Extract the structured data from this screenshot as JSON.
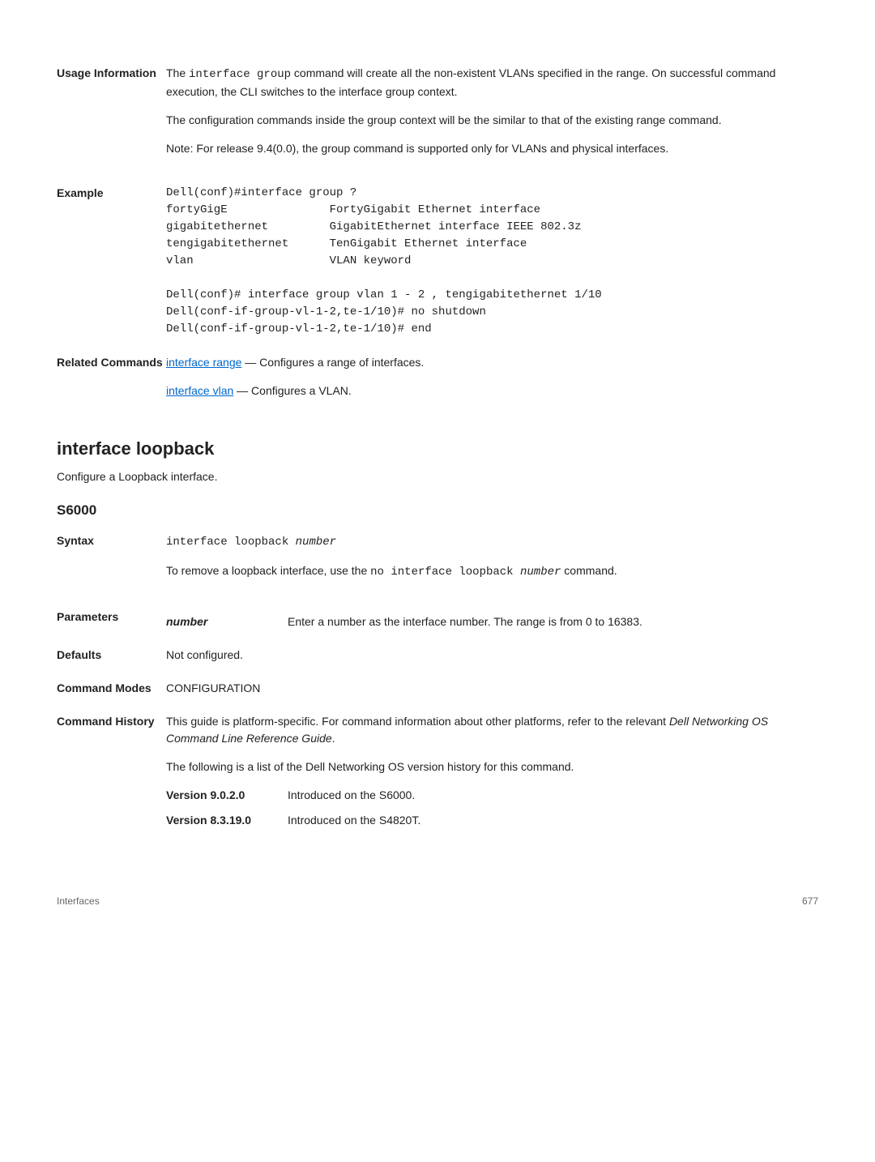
{
  "usage": {
    "label": "Usage Information",
    "p1a": "The ",
    "p1code": "interface group",
    "p1b": " command will create all the non-existent VLANs specified in the range. On successful command execution, the CLI switches to the interface group context.",
    "p2": "The configuration commands inside the group context will be the similar to that of the existing range command.",
    "p3": "Note: For release 9.4(0.0), the group command is supported only for VLANs and physical interfaces."
  },
  "example": {
    "label": "Example",
    "code": "Dell(conf)#interface group ?\nfortyGigE               FortyGigabit Ethernet interface\ngigabitethernet         GigabitEthernet interface IEEE 802.3z\ntengigabitethernet      TenGigabit Ethernet interface\nvlan                    VLAN keyword\n\nDell(conf)# interface group vlan 1 - 2 , tengigabitethernet 1/10\nDell(conf-if-group-vl-1-2,te-1/10)# no shutdown\nDell(conf-if-group-vl-1-2,te-1/10)# end"
  },
  "related": {
    "label": "Related Commands",
    "link1": "interface range",
    "desc1": " — Configures a range of interfaces.",
    "link2": "interface vlan",
    "desc2": " — Configures a VLAN."
  },
  "section_title": "interface loopback",
  "section_sub": "Configure a Loopback interface.",
  "s6000": "S6000",
  "syntax": {
    "label": "Syntax",
    "code": "interface loopback ",
    "codeItalic": "number",
    "desc1": "To remove a loopback interface, use the ",
    "descCode": "no interface loopback ",
    "descItalic": "number",
    "desc2": " command."
  },
  "params": {
    "label": "Parameters",
    "name": "number",
    "desc": "Enter a number as the interface number. The range is from 0 to 16383."
  },
  "defaults": {
    "label": "Defaults",
    "value": "Not configured."
  },
  "cmdmodes": {
    "label": "Command Modes",
    "value": "CONFIGURATION"
  },
  "history": {
    "label": "Command History",
    "p1a": "This guide is platform-specific. For command information about other platforms, refer to the relevant ",
    "p1i": "Dell Networking OS Command Line Reference Guide",
    "p1b": ".",
    "p2": "The following is a list of the Dell Networking OS version history for this command.",
    "v1": "Version 9.0.2.0",
    "v1desc": "Introduced on the S6000.",
    "v2": "Version 8.3.19.0",
    "v2desc": "Introduced on the S4820T."
  },
  "footer": {
    "left": "Interfaces",
    "right": "677"
  }
}
